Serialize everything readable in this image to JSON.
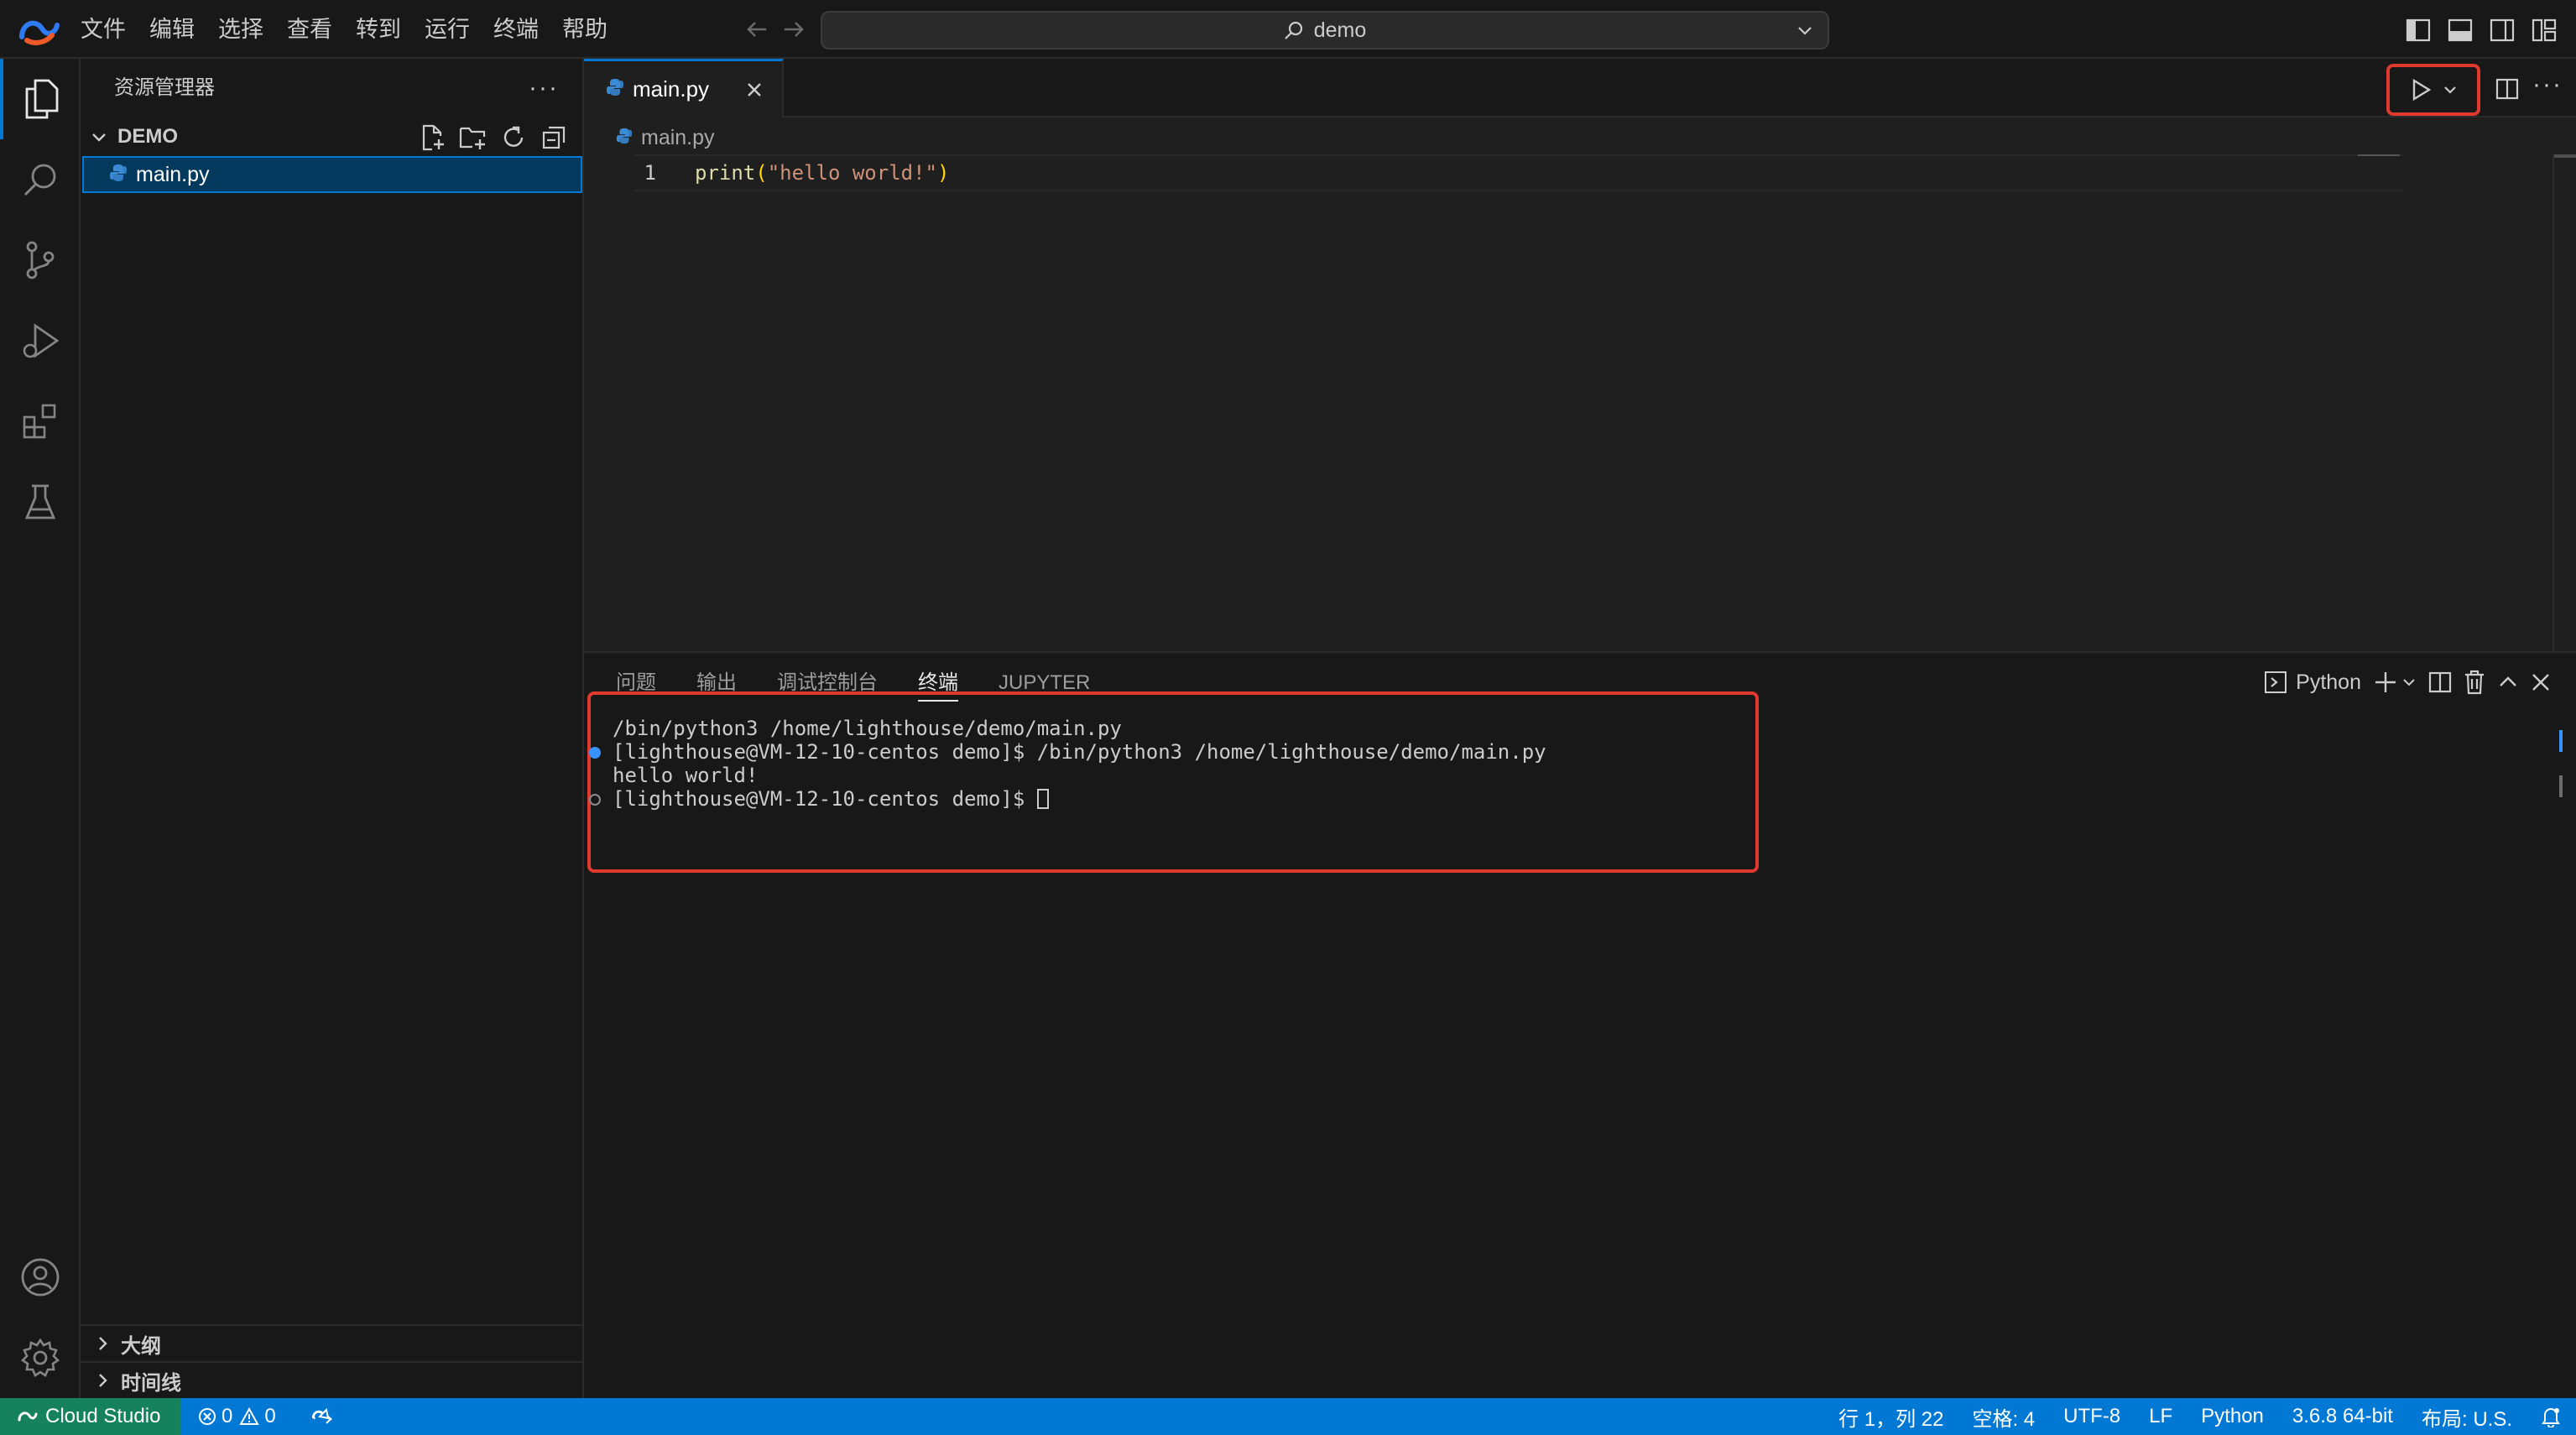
{
  "colors": {
    "accent": "#0078d4",
    "highlight_box": "#e03a2f",
    "remote_bg": "#16825d",
    "python_icon": "#3a8bd6"
  },
  "titlebar": {
    "menu": [
      "文件",
      "编辑",
      "选择",
      "查看",
      "转到",
      "运行",
      "终端",
      "帮助"
    ],
    "search_text": "demo"
  },
  "sidebar": {
    "title": "资源管理器",
    "more": "···",
    "folder": "DEMO",
    "files": [
      {
        "name": "main.py",
        "icon": "python-file-icon"
      }
    ],
    "sections": [
      "大纲",
      "时间线"
    ]
  },
  "editor": {
    "tab_label": "main.py",
    "breadcrumb": "main.py",
    "more": "···",
    "lines": [
      {
        "no": "1",
        "fn": "print",
        "open": "(",
        "str": "\"hello world!\"",
        "close": ")"
      }
    ]
  },
  "panel": {
    "tabs": [
      "问题",
      "输出",
      "调试控制台",
      "终端",
      "JUPYTER"
    ],
    "active_tab": "终端",
    "terminal_profile": "Python",
    "terminal": [
      {
        "text": "/bin/python3 /home/lighthouse/demo/main.py",
        "marker": "none"
      },
      {
        "text": "[lighthouse@VM-12-10-centos demo]$ /bin/python3 /home/lighthouse/demo/main.py",
        "marker": "filled"
      },
      {
        "text": "hello world!",
        "marker": "none"
      },
      {
        "text": "[lighthouse@VM-12-10-centos demo]$ ",
        "marker": "hollow"
      }
    ]
  },
  "statusbar": {
    "remote": "Cloud Studio",
    "errors": "0",
    "warnings": "0",
    "position": "行 1，列 22",
    "spaces": "空格: 4",
    "encoding": "UTF-8",
    "eol": "LF",
    "language": "Python",
    "interpreter": "3.6.8 64-bit",
    "layout": "布局: U.S."
  }
}
